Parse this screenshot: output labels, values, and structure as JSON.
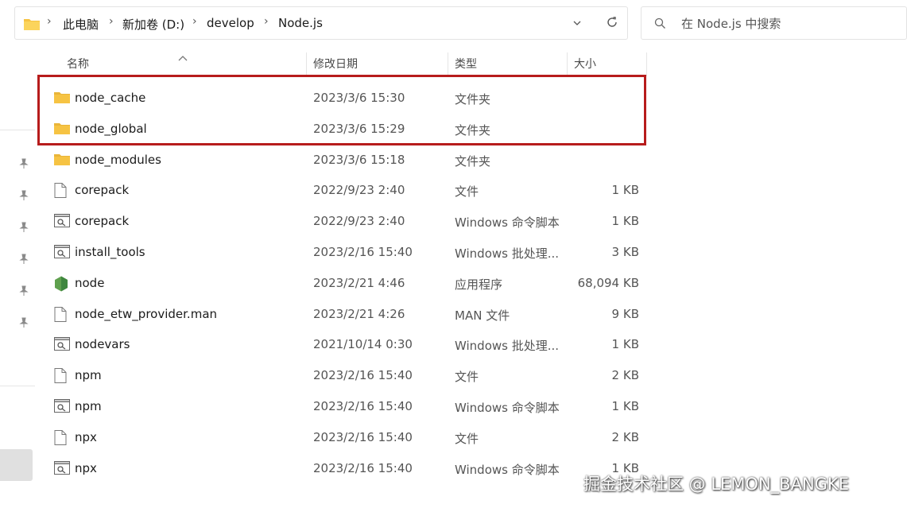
{
  "breadcrumb": {
    "items": [
      "此电脑",
      "新加卷 (D:)",
      "develop",
      "Node.js"
    ]
  },
  "search": {
    "placeholder": "在 Node.js 中搜索"
  },
  "columns": {
    "name": "名称",
    "date": "修改日期",
    "type": "类型",
    "size": "大小"
  },
  "files": [
    {
      "name": "node_cache",
      "date": "2023/3/6 15:30",
      "type": "文件夹",
      "size": "",
      "icon": "folder-icon"
    },
    {
      "name": "node_global",
      "date": "2023/3/6 15:29",
      "type": "文件夹",
      "size": "",
      "icon": "folder-icon"
    },
    {
      "name": "node_modules",
      "date": "2023/3/6 15:18",
      "type": "文件夹",
      "size": "",
      "icon": "folder-icon"
    },
    {
      "name": "corepack",
      "date": "2022/9/23 2:40",
      "type": "文件",
      "size": "1 KB",
      "icon": "file-icon"
    },
    {
      "name": "corepack",
      "date": "2022/9/23 2:40",
      "type": "Windows 命令脚本",
      "size": "1 KB",
      "icon": "script-icon"
    },
    {
      "name": "install_tools",
      "date": "2023/2/16 15:40",
      "type": "Windows 批处理...",
      "size": "3 KB",
      "icon": "script-icon"
    },
    {
      "name": "node",
      "date": "2023/2/21 4:46",
      "type": "应用程序",
      "size": "68,094 KB",
      "icon": "node-app-icon"
    },
    {
      "name": "node_etw_provider.man",
      "date": "2023/2/21 4:26",
      "type": "MAN 文件",
      "size": "9 KB",
      "icon": "file-icon"
    },
    {
      "name": "nodevars",
      "date": "2021/10/14 0:30",
      "type": "Windows 批处理...",
      "size": "1 KB",
      "icon": "script-icon"
    },
    {
      "name": "npm",
      "date": "2023/2/16 15:40",
      "type": "文件",
      "size": "2 KB",
      "icon": "file-icon"
    },
    {
      "name": "npm",
      "date": "2023/2/16 15:40",
      "type": "Windows 命令脚本",
      "size": "1 KB",
      "icon": "script-icon"
    },
    {
      "name": "npx",
      "date": "2023/2/16 15:40",
      "type": "文件",
      "size": "2 KB",
      "icon": "file-icon"
    },
    {
      "name": "npx",
      "date": "2023/2/16 15:40",
      "type": "Windows 命令脚本",
      "size": "1 KB",
      "icon": "script-icon"
    }
  ],
  "highlight_color": "#b71c1c",
  "folder_color": "#f6c343",
  "watermark": "掘金技术社区 @ LEMON_BANGKE"
}
